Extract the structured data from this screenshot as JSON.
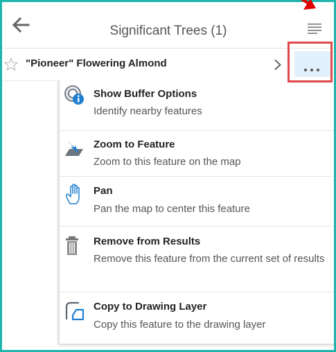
{
  "header": {
    "title": "Significant Trees (1)",
    "back_icon": "arrow-left-icon",
    "menu_icon": "hamburger-menu-icon"
  },
  "result_row": {
    "label": "\"Pioneer\" Flowering Almond",
    "star_icon": "star-outline-icon",
    "chevron_icon": "chevron-right-icon",
    "more_icon": "more-dots-icon"
  },
  "menu": {
    "items": [
      {
        "title": "Show Buffer Options",
        "description": "Identify nearby features",
        "icon": "buffer-info-icon"
      },
      {
        "title": "Zoom to Feature",
        "description": "Zoom to this feature on the map",
        "icon": "zoom-arrow-icon"
      },
      {
        "title": "Pan",
        "description": "Pan the map to center this feature",
        "icon": "hand-icon"
      },
      {
        "title": "Remove from Results",
        "description": "Remove this feature from the current set of results",
        "icon": "trash-icon"
      },
      {
        "title": "Copy to Drawing Layer",
        "description": "Copy this feature to the drawing layer",
        "icon": "copy-drawing-icon"
      }
    ]
  },
  "colors": {
    "frame": "#1fb5ad",
    "highlight": "#e0484a",
    "accent_blue": "#1e7fd0",
    "selected_bg": "#e2f0fb"
  }
}
